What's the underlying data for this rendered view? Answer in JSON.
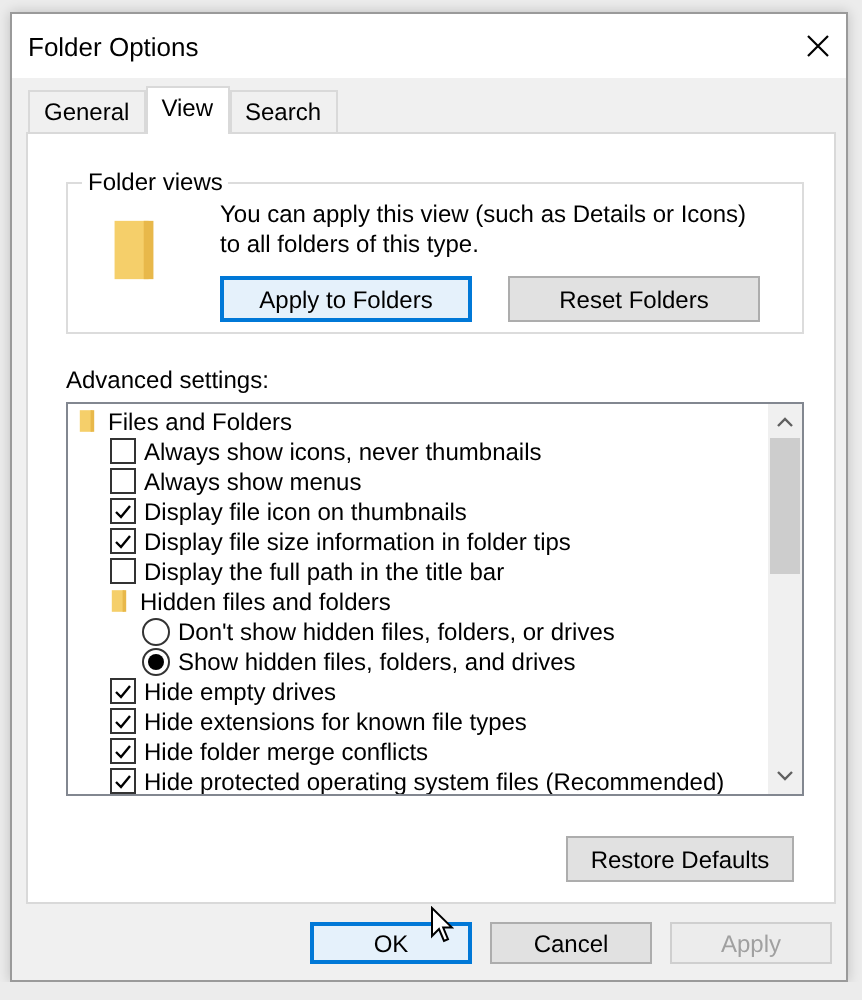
{
  "window": {
    "title": "Folder Options"
  },
  "tabs": [
    {
      "label": "General",
      "selected": false
    },
    {
      "label": "View",
      "selected": true
    },
    {
      "label": "Search",
      "selected": false
    }
  ],
  "folder_views": {
    "title": "Folder views",
    "description": "You can apply this view (such as Details or Icons) to all folders of this type.",
    "buttons": [
      {
        "label": "Apply to Folders",
        "focused": true
      },
      {
        "label": "Reset Folders",
        "focused": false
      }
    ]
  },
  "advanced_settings": {
    "label": "Advanced settings:",
    "items": [
      {
        "kind": "folder",
        "label": "Files and Folders",
        "children": [
          {
            "kind": "checkbox",
            "label": "Always show icons, never thumbnails",
            "checked": false
          },
          {
            "kind": "checkbox",
            "label": "Always show menus",
            "checked": false
          },
          {
            "kind": "checkbox",
            "label": "Display file icon on thumbnails",
            "checked": true
          },
          {
            "kind": "checkbox",
            "label": "Display file size information in folder tips",
            "checked": true
          },
          {
            "kind": "checkbox",
            "label": "Display the full path in the title bar",
            "checked": false
          },
          {
            "kind": "folder",
            "label": "Hidden files and folders",
            "children": [
              {
                "kind": "radio",
                "label": "Don't show hidden files, folders, or drives",
                "selected": false
              },
              {
                "kind": "radio",
                "label": "Show hidden files, folders, and drives",
                "selected": true
              }
            ]
          },
          {
            "kind": "checkbox",
            "label": "Hide empty drives",
            "checked": true
          },
          {
            "kind": "checkbox",
            "label": "Hide extensions for known file types",
            "checked": true
          },
          {
            "kind": "checkbox",
            "label": "Hide folder merge conflicts",
            "checked": true
          },
          {
            "kind": "checkbox",
            "label": "Hide protected operating system files (Recommended)",
            "checked": true
          }
        ]
      }
    ]
  },
  "restore_button": {
    "label": "Restore Defaults"
  },
  "dialog_buttons": [
    {
      "label": "OK",
      "focused": true,
      "disabled": false
    },
    {
      "label": "Cancel",
      "focused": false,
      "disabled": false
    },
    {
      "label": "Apply",
      "focused": false,
      "disabled": true
    }
  ]
}
